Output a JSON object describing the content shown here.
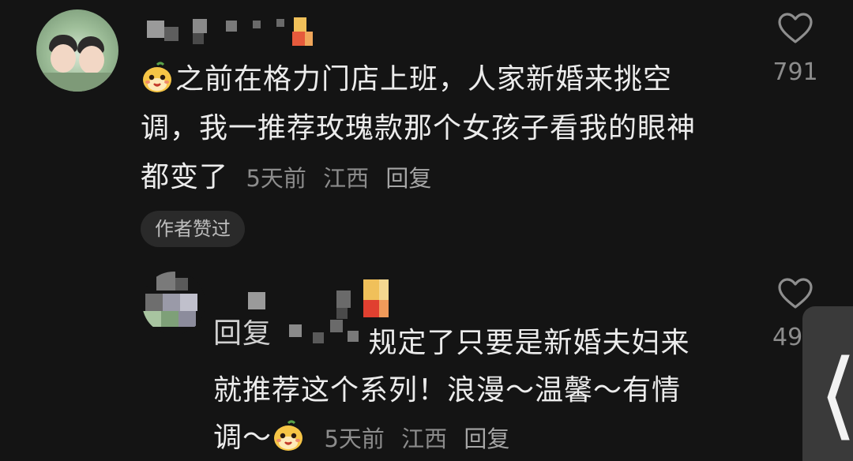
{
  "comment": {
    "text_line1": "之前在格力门店上班，人家新婚来挑空",
    "text_line2": "调，我一推荐玫瑰款那个女孩子看我的眼神",
    "text_line3": "都变了",
    "time": "5天前",
    "location": "江西",
    "reply_label": "回复",
    "author_liked": "作者赞过",
    "likes": "791",
    "emoji_icon": "cute-mango-face-emoji"
  },
  "reply": {
    "prefix": "回复",
    "text_line1": "规定了只要是新婚夫妇来",
    "text_line2": "就推荐这个系列！浪漫～温馨～有情",
    "text_line3": "调～",
    "time": "5天前",
    "location": "江西",
    "reply_label": "回复",
    "likes": "49",
    "emoji_icon": "cute-mango-face-emoji"
  },
  "side": {
    "handle_glyph": "❬"
  },
  "colors": {
    "background": "#141414",
    "text": "#ececec",
    "meta": "#8c8c8c",
    "badge_bg": "#2a2a2a",
    "handle_bg": "#3a3a3a"
  }
}
